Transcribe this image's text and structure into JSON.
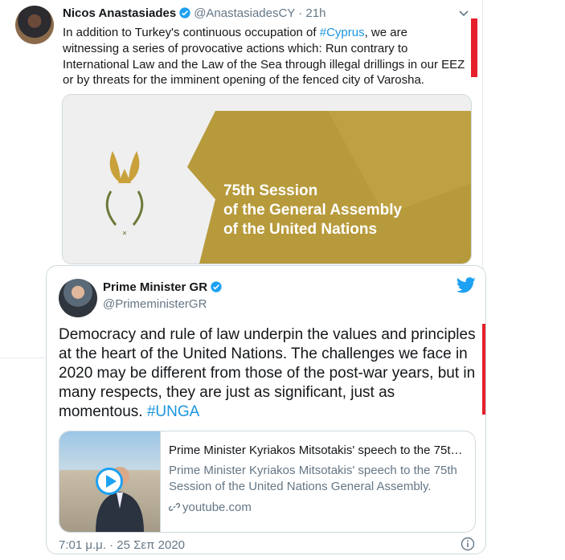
{
  "tweet1": {
    "name": "Nicos Anastasiades",
    "handle": "@AnastasiadesCY",
    "sep": "·",
    "time": "21h",
    "text_before": "In addition to Turkey's continuous occupation of ",
    "hashtag": "#Cyprus",
    "text_after": ", we are witnessing a series of provocative actions which: Run contrary to International Law and the Law of the Sea through illegal drillings in our EEZ or by threats for the imminent opening of the fenced city of Varosha.",
    "card_title": [
      "75th Session",
      "of the General Assembly",
      "of the United Nations"
    ]
  },
  "tweet2": {
    "name": "Prime Minister GR",
    "handle": "@PrimeministerGR",
    "text_before": "Democracy and rule of law underpin the values and principles at the heart of the United Nations. The challenges we face in 2020 may be different from those of the post-war years, but in many respects, they are just as significant, just as momentous. ",
    "hashtag": "#UNGA",
    "card": {
      "title": "Prime Minister Kyriakos Mitsotakis' speech to the 75th ...",
      "description": "Prime Minister Kyriakos Mitsotakis' speech to the 75th Session of the United Nations General Assembly.",
      "domain": "youtube.com"
    },
    "timestamp": "7:01 μ.μ. · 25 Σεπ 2020"
  },
  "colors": {
    "accent": "#1da1f2",
    "hashtag": "#1b95e0",
    "gold": "#b79a3b",
    "highlight_bar": "#e6202b"
  },
  "icons": [
    "verified-icon",
    "chevron-down-icon",
    "twitter-bird-icon",
    "play-icon",
    "link-icon",
    "info-icon"
  ]
}
